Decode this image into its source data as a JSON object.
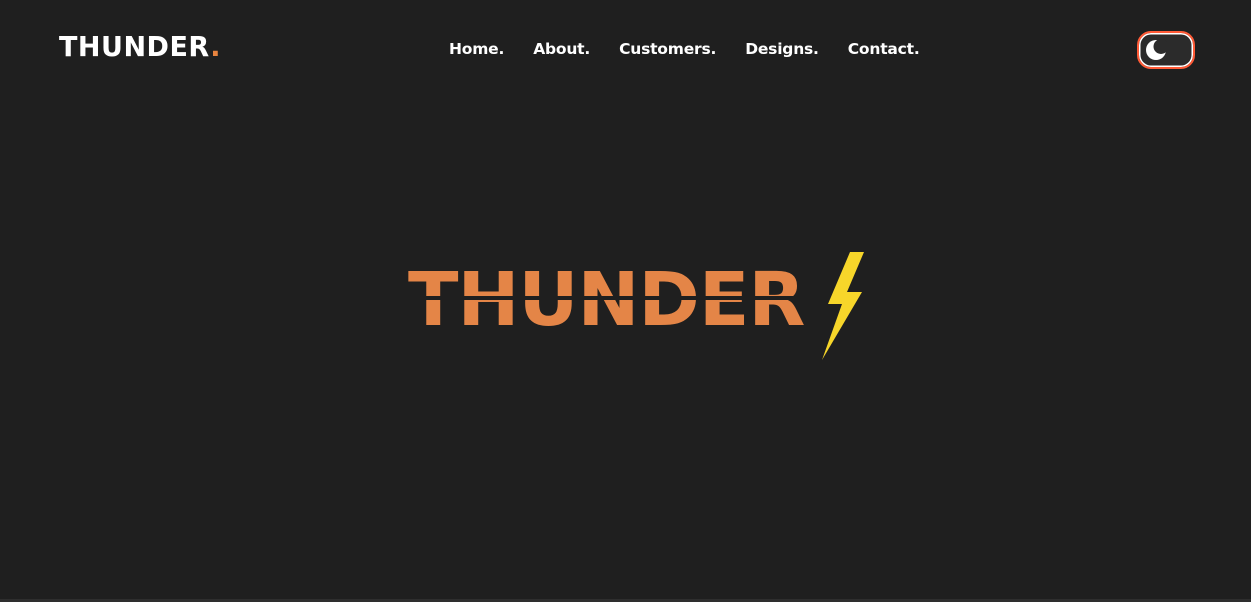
{
  "header": {
    "logo_text": "THUNDER",
    "logo_dot": ".",
    "nav": [
      {
        "label": "Home."
      },
      {
        "label": "About."
      },
      {
        "label": "Customers."
      },
      {
        "label": "Designs."
      },
      {
        "label": "Contact."
      }
    ],
    "theme_toggle": {
      "icon": "moon-icon",
      "state": "dark"
    }
  },
  "hero": {
    "logo_text": "THUNDER",
    "bolt_icon": "lightning-bolt-icon"
  },
  "colors": {
    "background": "#1f1f1f",
    "accent_orange": "#e48547",
    "toggle_border": "#ff5a36",
    "bolt_yellow": "#f7d62a",
    "text": "#ffffff"
  }
}
